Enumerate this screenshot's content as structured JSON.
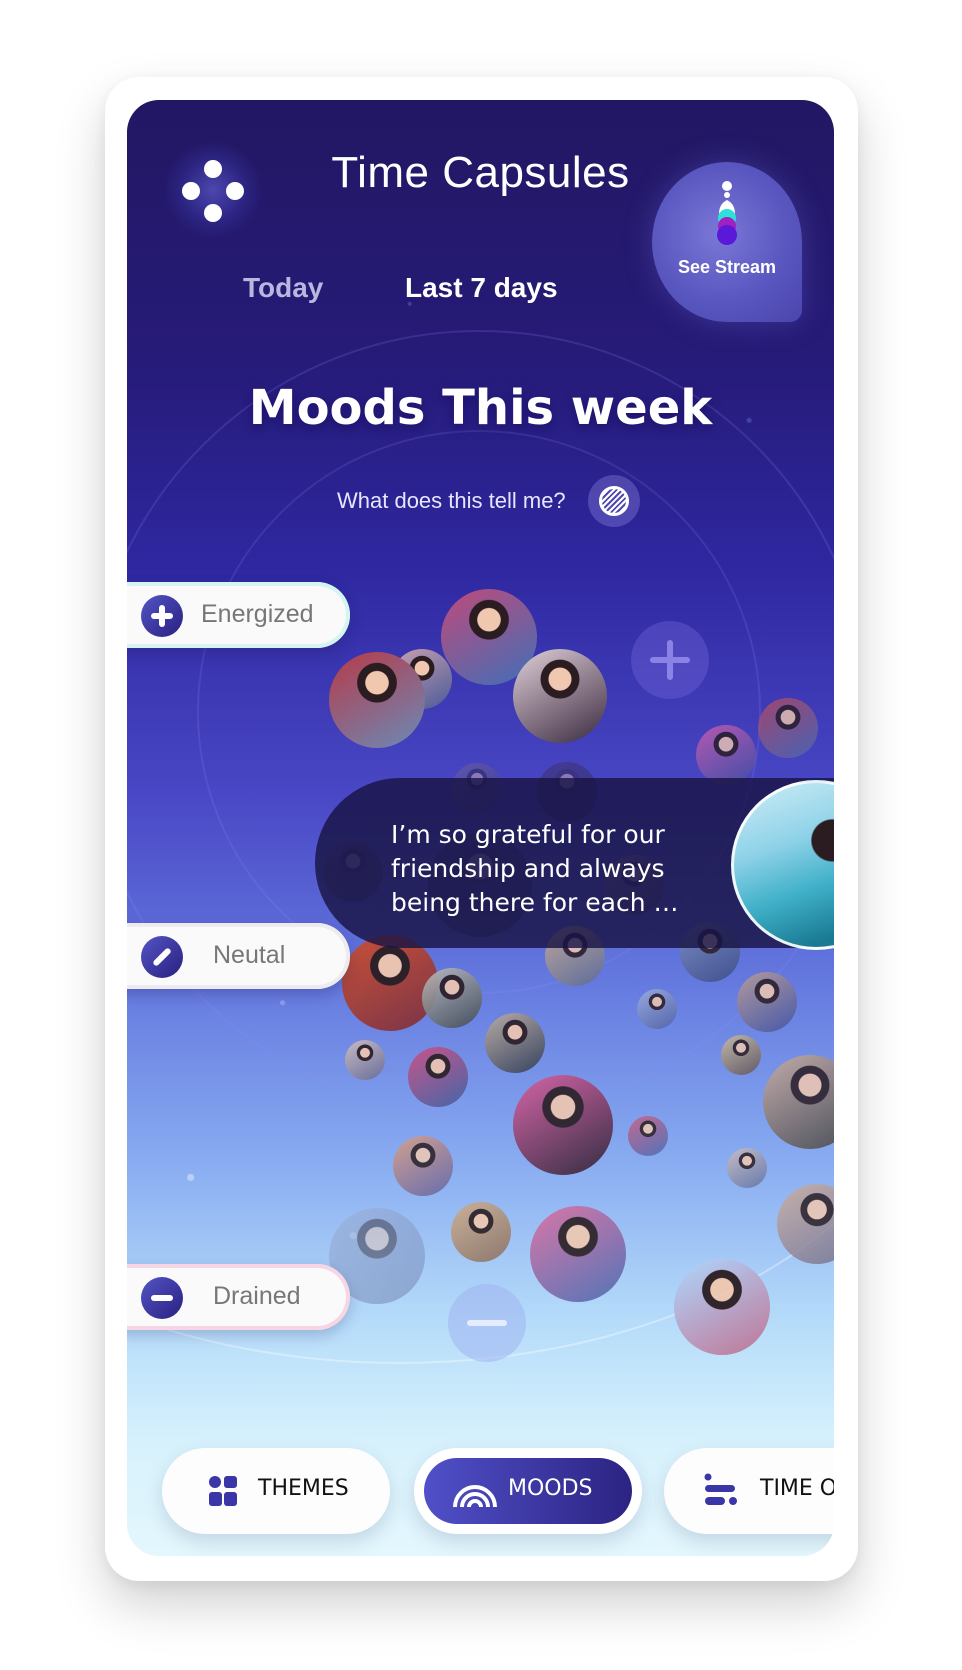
{
  "app": {
    "title": "Time Capsules",
    "menu_icon": "four-dots-icon"
  },
  "range_tabs": [
    {
      "label": "Today",
      "active": false
    },
    {
      "label": "Last 7 days",
      "active": true,
      "icon": "swap-arrows-icon"
    }
  ],
  "stream_button": {
    "label": "See Stream",
    "icon": "stream-stack-icon"
  },
  "heading": "Moods This week",
  "help": {
    "label": "What does this tell me?",
    "icon": "info-striped-icon"
  },
  "mood_levels": [
    {
      "label": "Energized",
      "icon": "plus-icon",
      "accent": "#d5f5f2"
    },
    {
      "label": "Neutal",
      "icon": "slash-icon",
      "accent": "#ececf0"
    },
    {
      "label": "Drained",
      "icon": "minus-icon",
      "accent": "#f6d6e4"
    }
  ],
  "highlight_entry": {
    "text": "I’m so grateful for our friendship and always being there for each …"
  },
  "bottom_nav": [
    {
      "label": "THEMES",
      "icon": "grid-icon",
      "active": false
    },
    {
      "label": "MOODS",
      "icon": "rainbow-icon",
      "active": true
    },
    {
      "label": "TIME O",
      "icon": "timeline-icon",
      "active": false
    }
  ],
  "colors": {
    "brand_dark": "#2a2080",
    "brand": "#5050c8",
    "stream_teal": "#2fe0d8",
    "stream_magenta": "#a020c0",
    "stream_violet": "#5a18d8"
  }
}
